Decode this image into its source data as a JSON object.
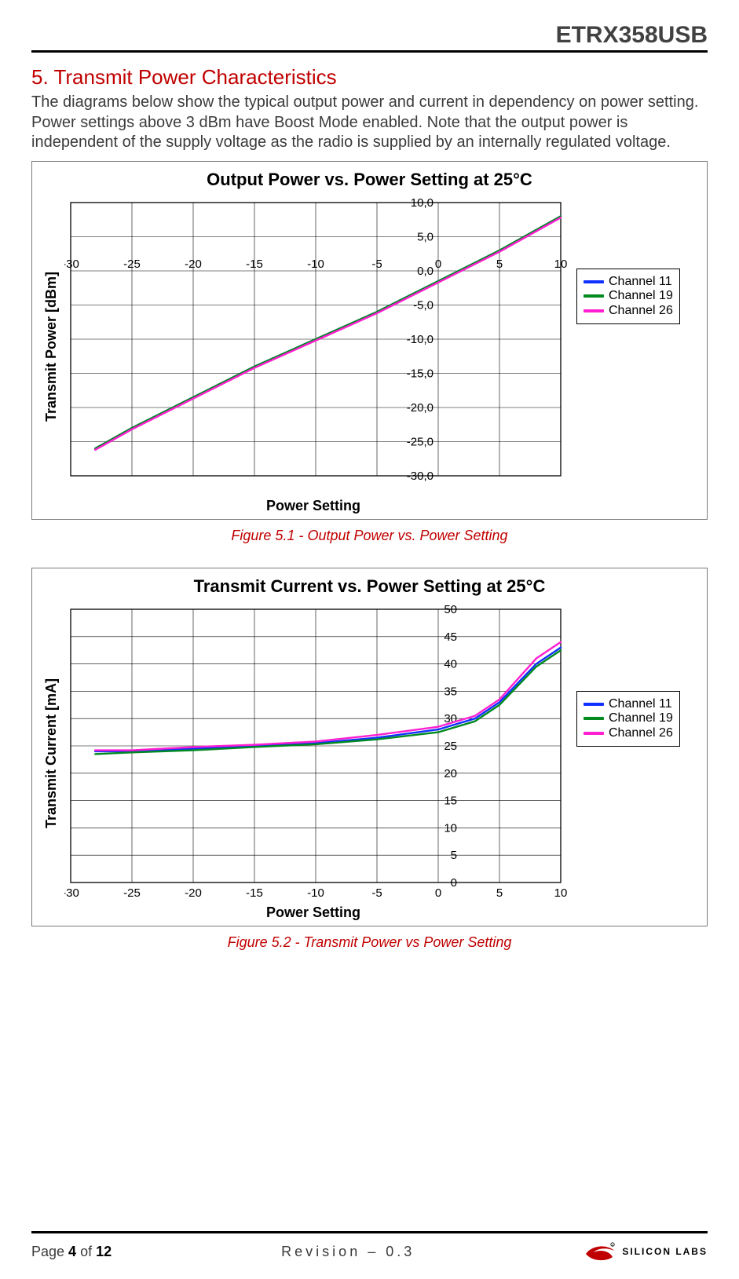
{
  "header": {
    "product": "ETRX358USB"
  },
  "section": {
    "number": "5.",
    "title": "Transmit Power Characteristics",
    "body": "The diagrams below show the typical output power and current in dependency on power setting.  Power settings above 3 dBm have Boost Mode enabled. Note that the output power is independent of the supply voltage as the radio is supplied by an internally regulated voltage."
  },
  "legend_items": [
    {
      "name": "Channel 11",
      "color": "#1030ff"
    },
    {
      "name": "Channel 19",
      "color": "#008a20"
    },
    {
      "name": "Channel 26",
      "color": "#ff1fd0"
    }
  ],
  "figure1_caption": "Figure 5.1 - Output Power vs. Power Setting",
  "figure2_caption": "Figure 5.2 - Transmit Power vs Power Setting",
  "chart_data": [
    {
      "id": "output_power",
      "type": "line",
      "title": "Output Power vs. Power Setting at 25°C",
      "xlabel": "Power Setting",
      "ylabel": "Transmit Power [dBm]",
      "xlim": [
        -30,
        10
      ],
      "ylim": [
        -30,
        10
      ],
      "xticks": [
        -30,
        -25,
        -20,
        -15,
        -10,
        -5,
        0,
        5,
        10
      ],
      "yticks": [
        "10,0",
        "5,0",
        "0,0",
        "-5,0",
        "-10,0",
        "-15,0",
        "-20,0",
        "-25,0",
        "-30,0"
      ],
      "ytick_values": [
        10,
        5,
        0,
        -5,
        -10,
        -15,
        -20,
        -25,
        -30
      ],
      "x": [
        -28,
        -25,
        -20,
        -15,
        -10,
        -5,
        0,
        5,
        8,
        10
      ],
      "series": [
        {
          "name": "Channel 11",
          "color": "#1030ff",
          "values": [
            -26,
            -23,
            -18.5,
            -14,
            -10,
            -6,
            -1.5,
            3,
            6,
            8
          ]
        },
        {
          "name": "Channel 19",
          "color": "#008a20",
          "values": [
            -26,
            -23,
            -18.5,
            -14,
            -10,
            -6,
            -1.5,
            3,
            6,
            8
          ]
        },
        {
          "name": "Channel 26",
          "color": "#ff1fd0",
          "values": [
            -26.2,
            -23.2,
            -18.7,
            -14.2,
            -10.2,
            -6.2,
            -1.7,
            2.8,
            5.8,
            7.8
          ]
        }
      ]
    },
    {
      "id": "transmit_current",
      "type": "line",
      "title": "Transmit Current vs. Power Setting at 25°C",
      "xlabel": "Power Setting",
      "ylabel": "Transmit Current [mA]",
      "xlim": [
        -30,
        10
      ],
      "ylim": [
        0,
        50
      ],
      "xticks": [
        -30,
        -25,
        -20,
        -15,
        -10,
        -5,
        0,
        5,
        10
      ],
      "yticks": [
        50,
        45,
        40,
        35,
        30,
        25,
        20,
        15,
        10,
        5,
        0
      ],
      "ytick_values": [
        50,
        45,
        40,
        35,
        30,
        25,
        20,
        15,
        10,
        5,
        0
      ],
      "x": [
        -28,
        -25,
        -20,
        -15,
        -10,
        -5,
        0,
        3,
        5,
        8,
        10
      ],
      "series": [
        {
          "name": "Channel 11",
          "color": "#1030ff",
          "values": [
            24,
            24,
            24.5,
            25,
            25.5,
            26.5,
            28,
            30,
            33,
            40,
            43
          ]
        },
        {
          "name": "Channel 19",
          "color": "#008a20",
          "values": [
            23.5,
            23.8,
            24.2,
            24.8,
            25.3,
            26.2,
            27.5,
            29.5,
            32.5,
            39.5,
            42.5
          ]
        },
        {
          "name": "Channel 26",
          "color": "#ff1fd0",
          "values": [
            24.2,
            24.2,
            24.8,
            25.2,
            25.8,
            27,
            28.5,
            30.5,
            33.5,
            41,
            44
          ]
        }
      ]
    }
  ],
  "footer": {
    "page_label_prefix": "Page ",
    "page_current": "4",
    "page_of": " of ",
    "page_total": "12",
    "revision": "Revision – 0.3",
    "brand": "SILICON LABS"
  },
  "colors": {
    "accent_red": "#c00000"
  }
}
